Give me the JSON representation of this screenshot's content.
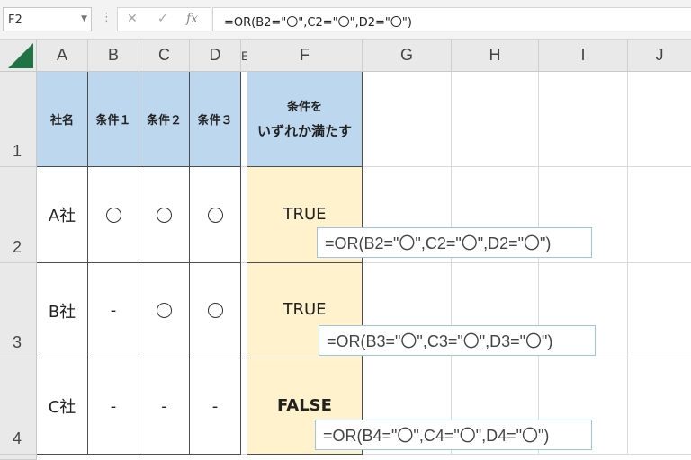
{
  "formula_bar": {
    "name_box": "F2",
    "cancel_icon": "✕",
    "enter_icon": "✓",
    "function_icon": "fx",
    "formula": "=OR(B2=\"〇\",C2=\"〇\",D2=\"〇\")"
  },
  "columns": [
    "A",
    "B",
    "C",
    "D",
    "E",
    "F",
    "G",
    "H",
    "I",
    "J"
  ],
  "rows": [
    "1",
    "2",
    "3",
    "4"
  ],
  "table": {
    "headers": [
      "社名",
      "条件１",
      "条件２",
      "条件３"
    ],
    "result_header_line1": "条件を",
    "result_header_line2": "いずれか満たす",
    "records": [
      {
        "company": "A社",
        "cond1": "circle",
        "cond2": "circle",
        "cond3": "circle",
        "result": "TRUE",
        "formula": "=OR(B2=\"〇\",C2=\"〇\",D2=\"〇\")"
      },
      {
        "company": "B社",
        "cond1": "-",
        "cond2": "circle",
        "cond3": "circle",
        "result": "TRUE",
        "formula": "=OR(B3=\"〇\",C3=\"〇\",D3=\"〇\")"
      },
      {
        "company": "C社",
        "cond1": "-",
        "cond2": "-",
        "cond3": "-",
        "result": "FALSE",
        "formula": "=OR(B4=\"〇\",C4=\"〇\",D4=\"〇\")"
      }
    ]
  },
  "colors": {
    "header_fill": "#bdd7ee",
    "result_fill": "#fff2cc",
    "excel_green": "#217346",
    "formula_box_border": "#9dc3e6"
  }
}
